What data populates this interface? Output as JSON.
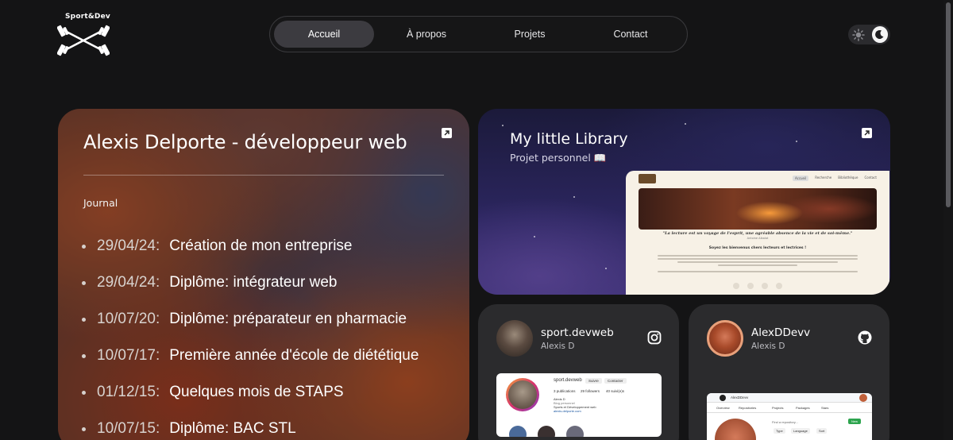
{
  "logo": {
    "brand": "Sport&Dev",
    "icon": "crossed-barbells-icon"
  },
  "nav": {
    "items": [
      {
        "label": "Accueil",
        "active": true
      },
      {
        "label": "À propos",
        "active": false
      },
      {
        "label": "Projets",
        "active": false
      },
      {
        "label": "Contact",
        "active": false
      }
    ]
  },
  "theme_toggle": {
    "options": [
      "sun-icon",
      "moon-icon"
    ],
    "selected": "dark"
  },
  "journal_card": {
    "title": "Alexis Delporte - développeur web",
    "section_label": "Journal",
    "entries": [
      {
        "date": "29/04/24:",
        "text": "Création de mon entreprise"
      },
      {
        "date": "29/04/24:",
        "text": "Diplôme: intégrateur web"
      },
      {
        "date": "10/07/20:",
        "text": "Diplôme: préparateur en pharmacie"
      },
      {
        "date": "10/07/17:",
        "text": "Première année d'école de diététique"
      },
      {
        "date": "01/12/15:",
        "text": "Quelques mois de STAPS"
      },
      {
        "date": "10/07/15:",
        "text": "Diplôme: BAC STL"
      }
    ]
  },
  "library_card": {
    "title": "My little Library",
    "subtitle": "Projet personnel 📖",
    "preview": {
      "nav": [
        "Accueil",
        "Recherche",
        "Bibliothèque",
        "Contact"
      ],
      "quote": "\"La lecture est un voyage de l'esprit, une agréable absence de la vie et de soi-même.\"",
      "quote_author": "Antoine Albalat",
      "welcome": "Soyez les bienvenus chers lecteurs et lectrices !"
    }
  },
  "instagram_card": {
    "handle": "sport.devweb",
    "name": "Alexis D",
    "preview": {
      "username": "sport.devweb",
      "buttons": [
        "Suivre",
        "Contacter"
      ],
      "stats": [
        "3 publications",
        "29 followers",
        "40 suivi(e)s"
      ],
      "bio": [
        "Alexis D",
        "Blog personnel",
        "Sports et Développement web",
        "alexis-delporte.com"
      ]
    }
  },
  "github_card": {
    "handle": "AlexDDevv",
    "name": "Alexis D",
    "preview": {
      "username": "AlexDDevv",
      "tabs": [
        "Overview",
        "Repositories",
        "Projects",
        "Packages",
        "Stars"
      ],
      "search_placeholder": "Find a repository...",
      "filters": [
        "Type",
        "Language",
        "Sort"
      ],
      "new_button": "New"
    }
  }
}
